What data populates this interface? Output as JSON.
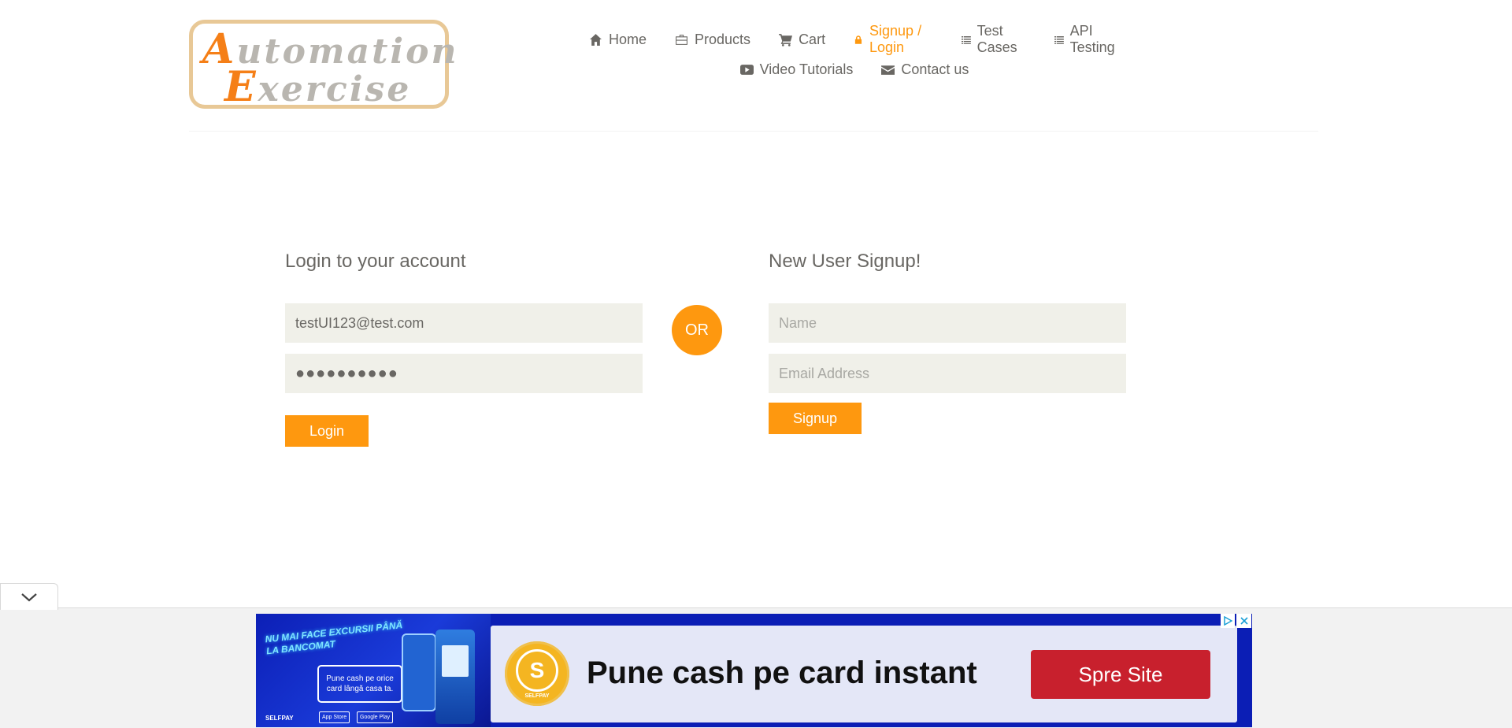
{
  "brand": {
    "line1_cap": "A",
    "line1_rest": "utomation",
    "line2_cap": "E",
    "line2_rest": "xercise"
  },
  "nav": {
    "row1": [
      {
        "label": "Home",
        "icon": "home-icon"
      },
      {
        "label": "Products",
        "icon": "briefcase-icon"
      },
      {
        "label": "Cart",
        "icon": "cart-icon"
      },
      {
        "label": "Signup / Login",
        "icon": "lock-icon",
        "active": true
      },
      {
        "label": "Test Cases",
        "icon": "list-icon"
      },
      {
        "label": "API Testing",
        "icon": "list-icon"
      }
    ],
    "row2": [
      {
        "label": "Video Tutorials",
        "icon": "youtube-play-icon"
      },
      {
        "label": "Contact us",
        "icon": "envelope-icon"
      }
    ]
  },
  "login": {
    "title": "Login to your account",
    "email_value": "testUI123@test.com",
    "password_mask": "●●●●●●●●●●",
    "button": "Login"
  },
  "or_label": "OR",
  "signup": {
    "title": "New User Signup!",
    "name_placeholder": "Name",
    "email_placeholder": "Email Address",
    "button": "Signup"
  },
  "ad": {
    "headline": "NU MAI FACE EXCURSII PÂNĂ LA BANCOMAT",
    "sub": "Pune cash pe orice card lângă casa ta.",
    "brand_small": "SELFPAY",
    "store1": "App Store",
    "store2": "Google Play",
    "logo_name": "SELFPAY",
    "main_text": "Pune cash pe card instant",
    "cta": "Spre Site"
  },
  "colors": {
    "accent": "#fe980f",
    "field_bg": "#f0f0e9",
    "text": "#696763",
    "ad_bg": "#0b1eb5",
    "ad_cta": "#c8202d"
  }
}
